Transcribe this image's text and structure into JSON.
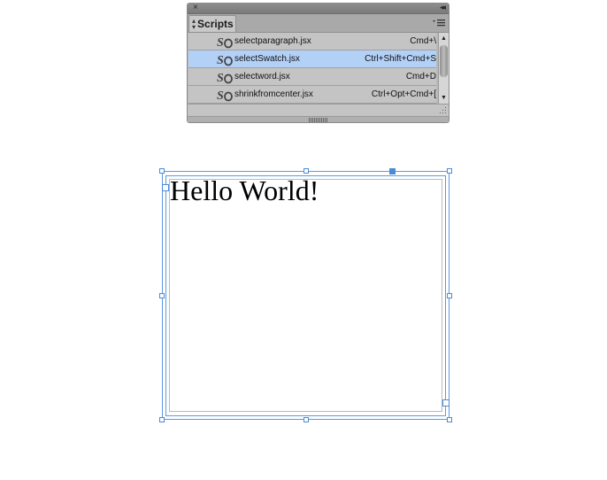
{
  "panel": {
    "title": "Scripts",
    "close_glyph": "×",
    "collapse_glyph": "◂◂",
    "menu_icon": "panel-menu-icon",
    "items": [
      {
        "name": "selectparagraph.jsx",
        "shortcut": "Cmd+\\",
        "selected": false
      },
      {
        "name": "selectSwatch.jsx",
        "shortcut": "Ctrl+Shift+Cmd+S",
        "selected": true
      },
      {
        "name": "selectword.jsx",
        "shortcut": "Cmd+D",
        "selected": false
      },
      {
        "name": "shrinkfromcenter.jsx",
        "shortcut": "Ctrl+Opt+Cmd+[",
        "selected": false
      }
    ]
  },
  "canvas": {
    "text_frame_content": "Hello World!"
  },
  "colors": {
    "selection_blue": "#4a8bd6",
    "row_selected": "#b3d0f7",
    "panel_bg": "#c4c4c4"
  }
}
